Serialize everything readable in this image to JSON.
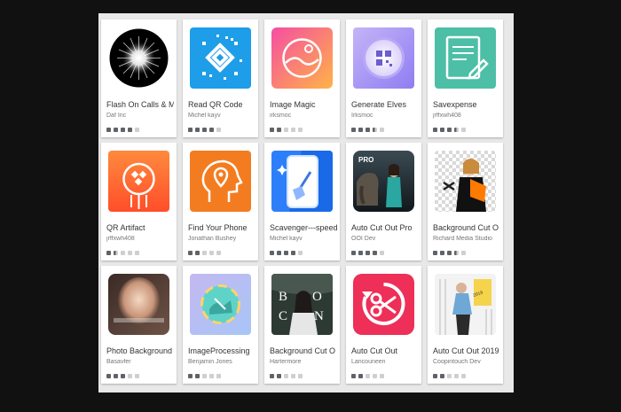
{
  "apps": [
    {
      "title": "Flash On Calls & M",
      "developer": "Daf Inc",
      "rating": 4,
      "icon": "flash-burst-icon"
    },
    {
      "title": "Read QR Code",
      "developer": "Michel kayv",
      "rating": 4,
      "icon": "qr-code-icon"
    },
    {
      "title": "Image Magic",
      "developer": "irksmoc",
      "rating": 2,
      "icon": "image-magic-icon"
    },
    {
      "title": "Generate Elves",
      "developer": "Irksmoc",
      "rating": 3.5,
      "icon": "qr-orb-icon"
    },
    {
      "title": "Savexpense",
      "developer": "jrffxwh408",
      "rating": 3.5,
      "icon": "document-pen-icon"
    },
    {
      "title": "QR Artifact",
      "developer": "jrffxwh408",
      "rating": 1.5,
      "icon": "qr-artifact-icon"
    },
    {
      "title": "Find Your Phone",
      "developer": "Jonathan Bushey",
      "rating": 2,
      "icon": "head-location-icon"
    },
    {
      "title": "Scavenger---speed",
      "developer": "Michel kayv",
      "rating": 4,
      "icon": "phone-broom-icon"
    },
    {
      "title": "Auto Cut Out Pro",
      "developer": "OOI Dev",
      "rating": 4,
      "icon": "elephant-photo-icon"
    },
    {
      "title": "Background Cut O",
      "developer": "Richard Media Studio",
      "rating": 3.5,
      "icon": "cutout-woman-icon"
    },
    {
      "title": "Photo Background",
      "developer": "Basavfer",
      "rating": 3,
      "icon": "portrait-blend-icon"
    },
    {
      "title": "ImageProcessing",
      "developer": "Benjamin Jones",
      "rating": 2,
      "icon": "circle-photo-icon"
    },
    {
      "title": "Background Cut O",
      "developer": "Hartermore",
      "rating": 2,
      "icon": "cut-cover-icon"
    },
    {
      "title": "Auto Cut Out",
      "developer": "Lancouneen",
      "rating": 2,
      "icon": "scissors-circle-icon"
    },
    {
      "title": "Auto Cut Out 2019",
      "developer": "Coopintouch Dev",
      "rating": 2,
      "icon": "auto-cut-2019-icon"
    }
  ]
}
